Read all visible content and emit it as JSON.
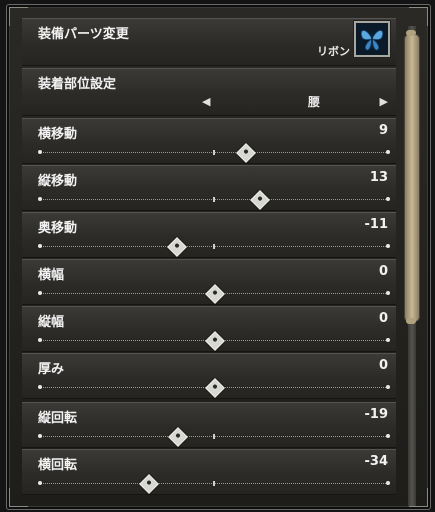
{
  "header": {
    "title": "装備パーツ変更",
    "item_name": "リボン",
    "item_icon": "butterfly-ribbon-icon"
  },
  "part_setting": {
    "label": "装着部位設定",
    "value": "腰",
    "prev_glyph": "◀",
    "next_glyph": "▶"
  },
  "sliders": [
    {
      "label": "横移動",
      "value": "9",
      "min": -50,
      "max": 50,
      "current": 9
    },
    {
      "label": "縦移動",
      "value": "13",
      "min": -50,
      "max": 50,
      "current": 13
    },
    {
      "label": "奥移動",
      "value": "-11",
      "min": -50,
      "max": 50,
      "current": -11
    },
    {
      "label": "横幅",
      "value": "0",
      "min": -50,
      "max": 50,
      "current": 0
    },
    {
      "label": "縦幅",
      "value": "0",
      "min": -50,
      "max": 50,
      "current": 0
    },
    {
      "label": "厚み",
      "value": "0",
      "min": -50,
      "max": 50,
      "current": 0
    },
    {
      "label": "縦回転",
      "value": "-19",
      "min": -90,
      "max": 90,
      "current": -19
    },
    {
      "label": "横回転",
      "value": "-34",
      "min": -90,
      "max": 90,
      "current": -34
    }
  ]
}
